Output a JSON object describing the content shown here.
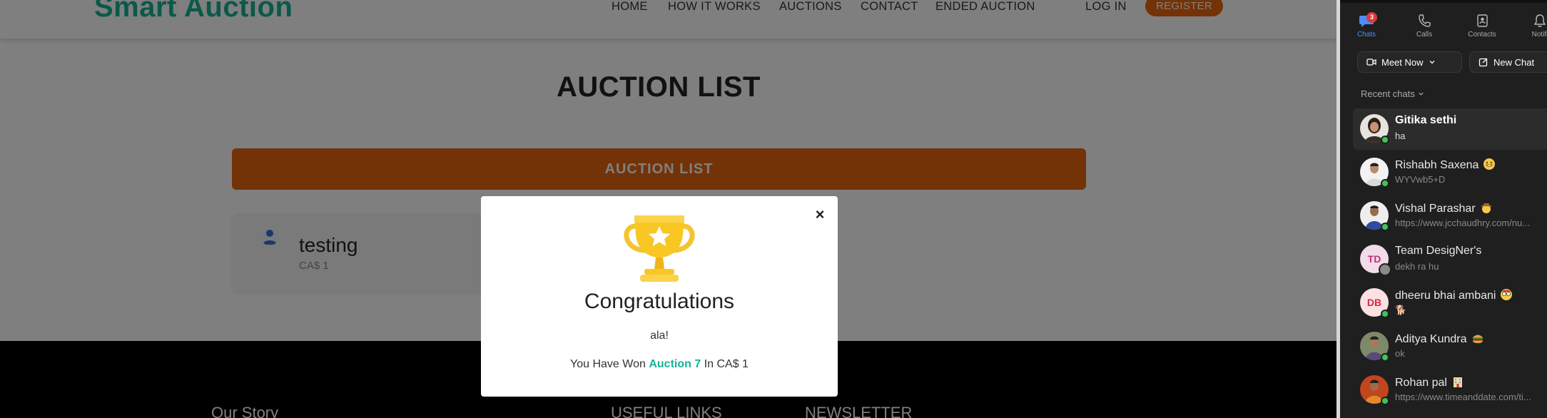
{
  "site": {
    "logo": "Smart Auction",
    "nav": [
      "HOME",
      "HOW IT WORKS",
      "AUCTIONS",
      "CONTACT",
      "ENDED AUCTION"
    ],
    "login": "LOG IN",
    "register": "REGISTER",
    "page_title": "AUCTION LIST",
    "list_bar": "AUCTION LIST",
    "card": {
      "title": "testing",
      "price": "CA$ 1"
    },
    "footer": [
      "Our Story",
      "USEFUL LINKS",
      "NEWSLETTER"
    ]
  },
  "modal": {
    "heading": "Congratulations",
    "message": "ala!",
    "won_prefix": "You Have Won",
    "auction_name": "Auction 7",
    "won_suffix": "In CA$ 1",
    "close": "×"
  },
  "chat": {
    "tabs": [
      {
        "label": "Chats",
        "icon": "chat-icon",
        "badge": "3"
      },
      {
        "label": "Calls",
        "icon": "phone-icon"
      },
      {
        "label": "Contacts",
        "icon": "contacts-icon"
      },
      {
        "label": "Notifi",
        "icon": "bell-icon"
      }
    ],
    "meet_now": "Meet Now",
    "new_chat": "New Chat",
    "recent_label": "Recent chats",
    "items": [
      {
        "name": "Gitika sethi",
        "preview": "ha",
        "avatar": "photo",
        "presence": true
      },
      {
        "name": "Rishabh Saxena",
        "preview": "WYVwb5+D",
        "avatar": "photo",
        "presence": true,
        "emoji": "grinning"
      },
      {
        "name": "Vishal Parashar",
        "preview": "https://www.jcchaudhry.com/nu...",
        "avatar": "photo",
        "presence": true,
        "emoji": "cowboy"
      },
      {
        "name": "Team DesigNer's",
        "preview": "dekh ra hu",
        "avatar": "TD",
        "presence": false
      },
      {
        "name": "dheeru bhai ambani",
        "preview": "🐕",
        "avatar": "DB",
        "presence": true,
        "emoji": "face"
      },
      {
        "name": "Aditya Kundra",
        "preview": "ok",
        "avatar": "photo",
        "presence": true,
        "emoji": "burger"
      },
      {
        "name": "Rohan pal",
        "preview": "https://www.timeanddate.com/ti...",
        "avatar": "photo",
        "presence": true,
        "emoji": "building"
      }
    ],
    "colors": {
      "accent": "#4d8df8",
      "presence": "#3fc45a",
      "badge": "#d93b3b"
    }
  },
  "colors": {
    "brand": "#15b394",
    "orange": "#e8650f"
  }
}
